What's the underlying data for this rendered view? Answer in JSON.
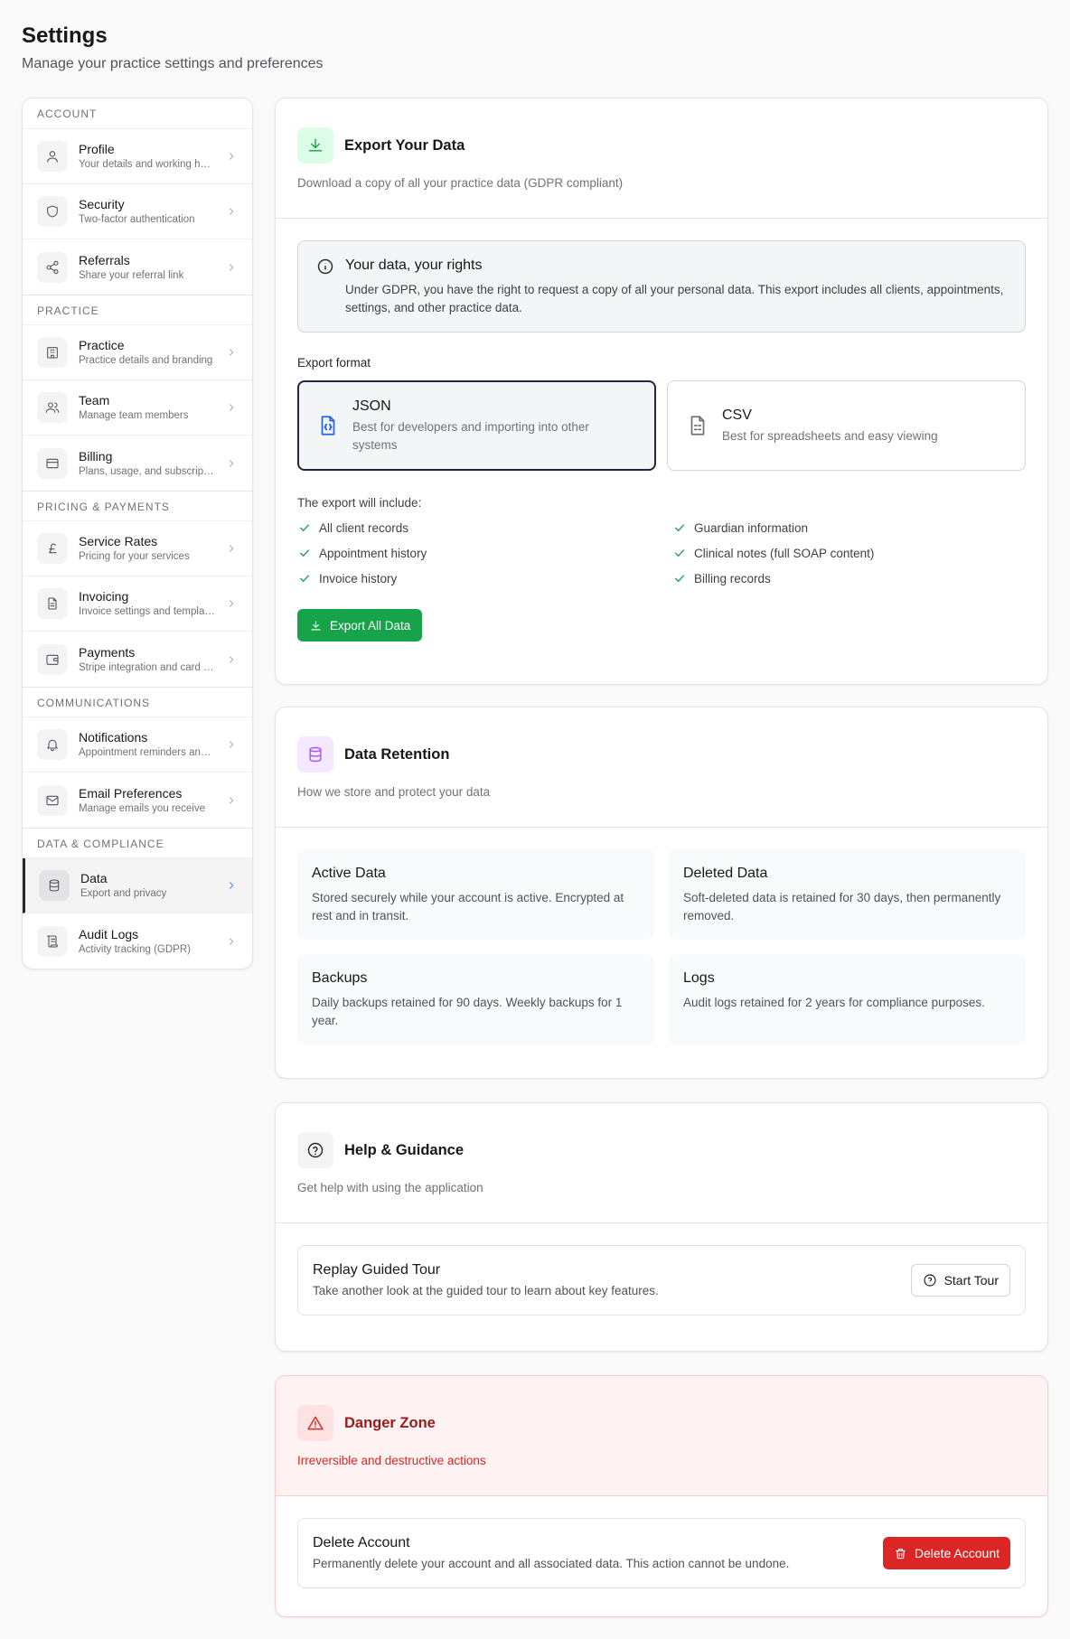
{
  "header": {
    "title": "Settings",
    "subtitle": "Manage your practice settings and preferences"
  },
  "sidebar": {
    "groups": [
      {
        "label": "Account",
        "items": [
          {
            "title": "Profile",
            "desc": "Your details and working hours",
            "icon": "user-icon"
          },
          {
            "title": "Security",
            "desc": "Two-factor authentication",
            "icon": "shield-icon"
          },
          {
            "title": "Referrals",
            "desc": "Share your referral link",
            "icon": "share-icon"
          }
        ]
      },
      {
        "label": "Practice",
        "items": [
          {
            "title": "Practice",
            "desc": "Practice details and branding",
            "icon": "building-icon"
          },
          {
            "title": "Team",
            "desc": "Manage team members",
            "icon": "users-icon"
          },
          {
            "title": "Billing",
            "desc": "Plans, usage, and subscription",
            "icon": "credit-card-icon"
          }
        ]
      },
      {
        "label": "Pricing & Payments",
        "items": [
          {
            "title": "Service Rates",
            "desc": "Pricing for your services",
            "icon": "pound-icon"
          },
          {
            "title": "Invoicing",
            "desc": "Invoice settings and templates",
            "icon": "file-text-icon"
          },
          {
            "title": "Payments",
            "desc": "Stripe integration and card payments",
            "icon": "wallet-icon"
          }
        ]
      },
      {
        "label": "Communications",
        "items": [
          {
            "title": "Notifications",
            "desc": "Appointment reminders and alerts",
            "icon": "bell-icon"
          },
          {
            "title": "Email Preferences",
            "desc": "Manage emails you receive",
            "icon": "mail-icon"
          }
        ]
      },
      {
        "label": "Data & Compliance",
        "items": [
          {
            "title": "Data",
            "desc": "Export and privacy",
            "icon": "database-icon",
            "active": true
          },
          {
            "title": "Audit Logs",
            "desc": "Activity tracking (GDPR)",
            "icon": "scroll-icon"
          }
        ]
      }
    ]
  },
  "export": {
    "title": "Export Your Data",
    "subtitle": "Download a copy of all your practice data (GDPR compliant)",
    "info_title": "Your data, your rights",
    "info_body": "Under GDPR, you have the right to request a copy of all your personal data. This export includes all clients, appointments, settings, and other practice data.",
    "format_label": "Export format",
    "formats": [
      {
        "title": "JSON",
        "desc": "Best for developers and importing into other systems",
        "selected": true
      },
      {
        "title": "CSV",
        "desc": "Best for spreadsheets and easy viewing",
        "selected": false
      }
    ],
    "includes_label": "The export will include:",
    "includes": [
      "All client records",
      "Guardian information",
      "Appointment history",
      "Clinical notes (full SOAP content)",
      "Invoice history",
      "Billing records"
    ],
    "button": "Export All Data"
  },
  "retention": {
    "title": "Data Retention",
    "subtitle": "How we store and protect your data",
    "tiles": [
      {
        "title": "Active Data",
        "desc": "Stored securely while your account is active. Encrypted at rest and in transit."
      },
      {
        "title": "Deleted Data",
        "desc": "Soft-deleted data is retained for 30 days, then permanently removed."
      },
      {
        "title": "Backups",
        "desc": "Daily backups retained for 90 days. Weekly backups for 1 year."
      },
      {
        "title": "Logs",
        "desc": "Audit logs retained for 2 years for compliance purposes."
      }
    ]
  },
  "help": {
    "title": "Help & Guidance",
    "subtitle": "Get help with using the application",
    "row_title": "Replay Guided Tour",
    "row_desc": "Take another look at the guided tour to learn about key features.",
    "button": "Start Tour"
  },
  "danger": {
    "title": "Danger Zone",
    "subtitle": "Irreversible and destructive actions",
    "row_title": "Delete Account",
    "row_desc": "Permanently delete your account and all associated data. This action cannot be undone.",
    "button": "Delete Account"
  },
  "colors": {
    "accent_green": "#16a34a",
    "danger_red": "#dc2626",
    "export_icon_bg": "#dcfce7",
    "retention_icon_bg": "#f3e8ff",
    "retention_icon": "#a855f7",
    "json_icon": "#2563eb"
  }
}
